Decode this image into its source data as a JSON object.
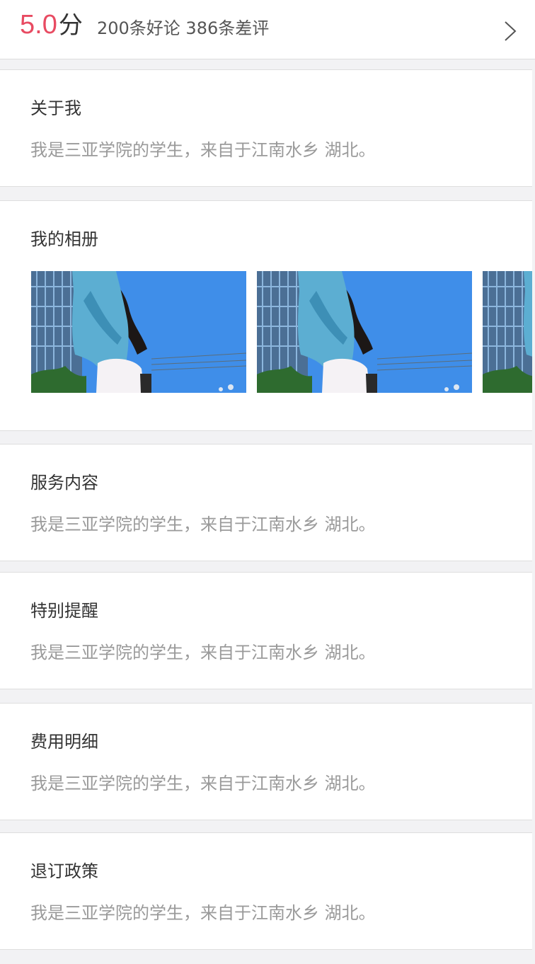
{
  "rating": {
    "score": "5.0",
    "unit": "分",
    "counts": "200条好论 386条差评",
    "accent_color": "#e84b62"
  },
  "sections": {
    "about": {
      "title": "关于我",
      "text": "我是三亚学院的学生，来自于江南水乡 湖北。"
    },
    "album": {
      "title": "我的相册",
      "photo_count_visible": 3
    },
    "services": {
      "title": "服务内容",
      "text": "我是三亚学院的学生，来自于江南水乡 湖北。"
    },
    "reminder": {
      "title": "特别提醒",
      "text": "我是三亚学院的学生，来自于江南水乡 湖北。"
    },
    "fees": {
      "title": "费用明细",
      "text": "我是三亚学院的学生，来自于江南水乡 湖北。"
    },
    "refund": {
      "title": "退订政策",
      "text": "我是三亚学院的学生，来自于江南水乡 湖北。"
    }
  },
  "icons": {
    "rating_arrow": "chevron-right-icon"
  }
}
